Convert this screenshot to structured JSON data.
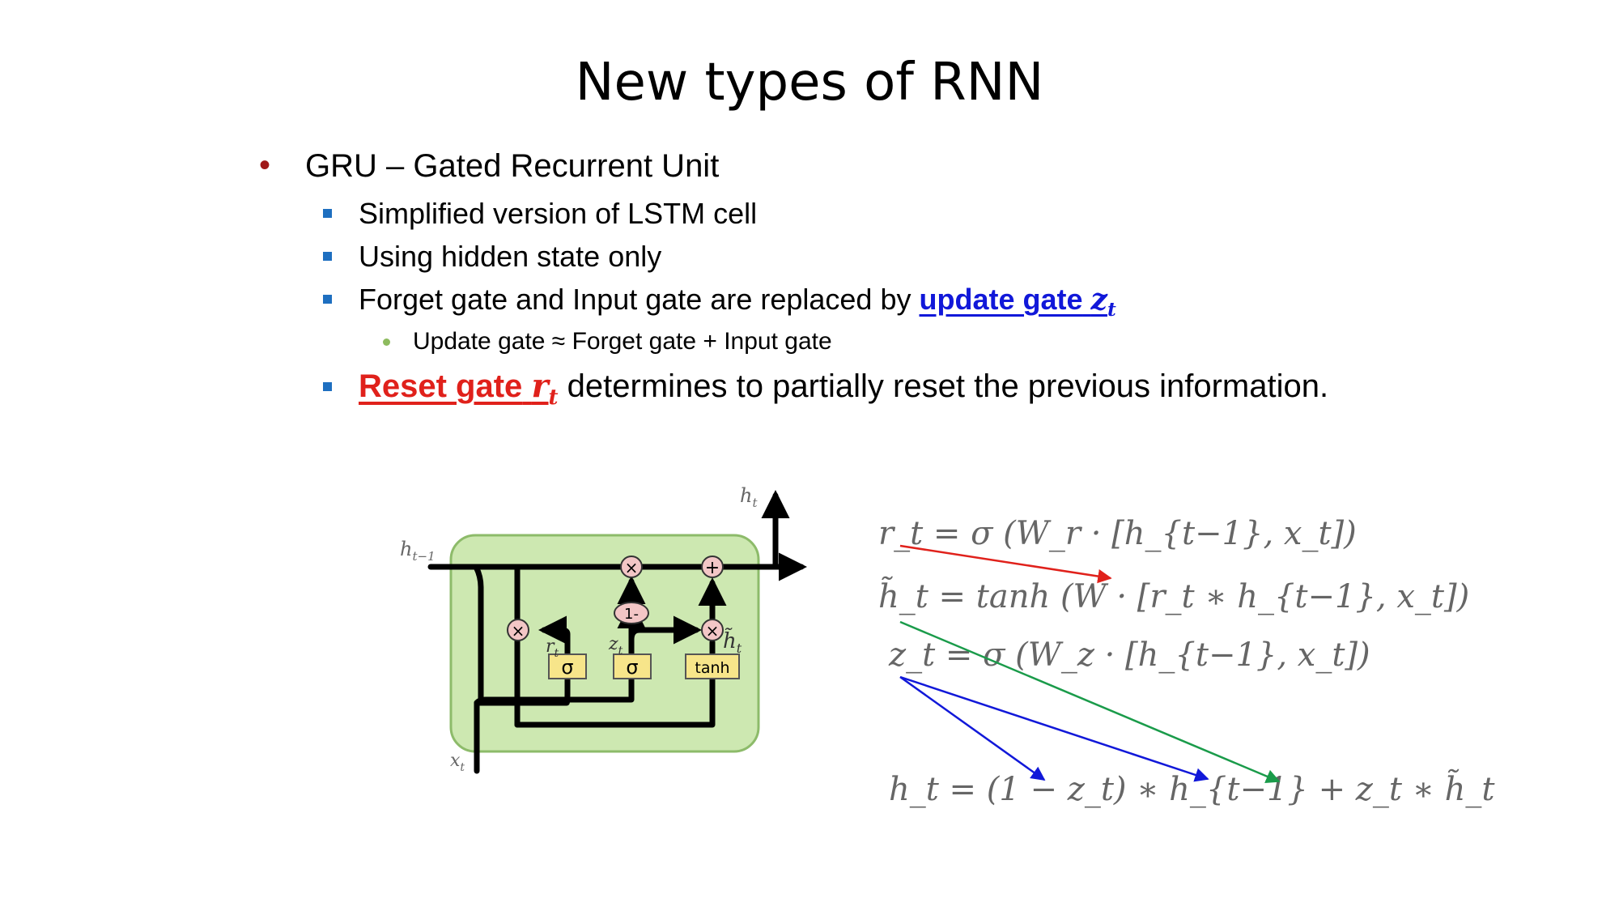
{
  "slide": {
    "title": "New types of RNN",
    "bullets": {
      "main": "GRU – Gated Recurrent Unit",
      "sub1": "Simplified version of LSTM cell",
      "sub2": "Using hidden state only",
      "sub3_prefix": "Forget gate and Input gate are replaced by ",
      "sub3_highlight": "update gate",
      "sub3_var": "z",
      "sub3_sub": "t",
      "sub3_1": "Update gate ≈ Forget gate + Input gate",
      "sub4_highlight": "Reset gate",
      "sub4_var": "r",
      "sub4_sub": "t",
      "sub4_suffix": " determines to partially reset the previous information."
    }
  },
  "diagram": {
    "label_ht_out": "h",
    "label_ht_out_sub": "t",
    "label_htm1": "h",
    "label_htm1_sub": "t−1",
    "label_xt": "x",
    "label_xt_sub": "t",
    "label_rt": "r",
    "label_rt_sub": "t",
    "label_zt": "z",
    "label_zt_sub": "t",
    "label_htilde": "h̃",
    "label_htilde_sub": "t",
    "op_times": "×",
    "op_plus": "+",
    "op_one_minus": "1-",
    "gate_sigma": "σ",
    "gate_tanh": "tanh",
    "colors": {
      "cell_fill": "#cde8b1",
      "cell_stroke": "#8dbb6a",
      "op_fill": "#f3c6c6",
      "gate_fill": "#f7e58a"
    }
  },
  "equations": {
    "eq1": "r_t = σ (W_r · [h_{t−1}, x_t])",
    "eq2": "h̃_t = tanh (W · [r_t ∗ h_{t−1}, x_t])",
    "eq3": "z_t = σ (W_z · [h_{t−1}, x_t])",
    "eq4": "h_t = (1 − z_t) ∗ h_{t−1} + z_t ∗ h̃_t",
    "arrow_colors": {
      "reset": "#e0211b",
      "update": "#1118d9",
      "candidate": "#1a9b4a"
    }
  }
}
